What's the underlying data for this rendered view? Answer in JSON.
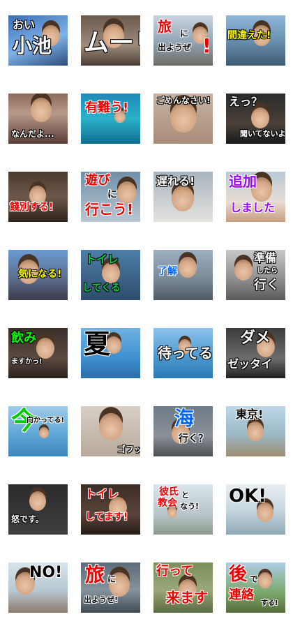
{
  "stickers": [
    {
      "lines": [
        {
          "t": "おい"
        },
        {
          "t": "小池"
        }
      ]
    },
    {
      "lines": [
        {
          "t": "ムーリ"
        }
      ]
    },
    {
      "lines": [
        {
          "t": "旅"
        },
        {
          "t": "に"
        },
        {
          "t": "出ようぜ"
        },
        {
          "t": "!"
        }
      ]
    },
    {
      "lines": [
        {
          "t": "間違えた!"
        }
      ]
    },
    {
      "lines": [
        {
          "t": "なんだよ..."
        }
      ]
    },
    {
      "lines": [
        {
          "t": "有難う!"
        }
      ]
    },
    {
      "lines": [
        {
          "t": "ごめんなさい!"
        }
      ]
    },
    {
      "lines": [
        {
          "t": "えっ？"
        },
        {
          "t": "聞いてないよ？"
        }
      ]
    },
    {
      "lines": [
        {
          "t": "餞別する!"
        }
      ]
    },
    {
      "lines": [
        {
          "t": "遊び"
        },
        {
          "t": "に"
        },
        {
          "t": "行こう!"
        }
      ]
    },
    {
      "lines": [
        {
          "t": "遅れる!"
        }
      ]
    },
    {
      "lines": [
        {
          "t": "追加"
        },
        {
          "t": "しました"
        }
      ]
    },
    {
      "lines": [
        {
          "t": "気になる!"
        }
      ]
    },
    {
      "lines": [
        {
          "t": "トイレ"
        },
        {
          "t": "してくる"
        }
      ]
    },
    {
      "lines": [
        {
          "t": "了解"
        }
      ]
    },
    {
      "lines": [
        {
          "t": "準備"
        },
        {
          "t": "したら"
        },
        {
          "t": "行く"
        }
      ]
    },
    {
      "lines": [
        {
          "t": "飲み"
        },
        {
          "t": "ますかっ!"
        }
      ]
    },
    {
      "lines": [
        {
          "t": "夏"
        }
      ]
    },
    {
      "lines": [
        {
          "t": "待ってる"
        }
      ]
    },
    {
      "lines": [
        {
          "t": "ダメ"
        },
        {
          "t": "ゼッタイ"
        }
      ]
    },
    {
      "lines": [
        {
          "t": "今"
        },
        {
          "t": "向かってる!"
        }
      ]
    },
    {
      "lines": [
        {
          "t": "ゴフッ"
        }
      ]
    },
    {
      "lines": [
        {
          "t": "海"
        },
        {
          "t": "行く？"
        }
      ]
    },
    {
      "lines": [
        {
          "t": "東京!"
        }
      ]
    },
    {
      "lines": [
        {
          "t": "怒です。"
        }
      ]
    },
    {
      "lines": [
        {
          "t": "トイレ"
        },
        {
          "t": "してます!"
        }
      ]
    },
    {
      "lines": [
        {
          "t": "彼氏"
        },
        {
          "t": "と"
        },
        {
          "t": "教会"
        },
        {
          "t": "なう!"
        }
      ]
    },
    {
      "lines": [
        {
          "t": "OK!"
        }
      ]
    },
    {
      "lines": [
        {
          "t": "NO!"
        }
      ]
    },
    {
      "lines": [
        {
          "t": "旅"
        },
        {
          "t": "に"
        },
        {
          "t": "出ようぜ!"
        }
      ]
    },
    {
      "lines": [
        {
          "t": "行って"
        },
        {
          "t": "来ます"
        }
      ]
    },
    {
      "lines": [
        {
          "t": "後"
        },
        {
          "t": "で"
        },
        {
          "t": "連絡"
        },
        {
          "t": "する!"
        }
      ]
    }
  ]
}
